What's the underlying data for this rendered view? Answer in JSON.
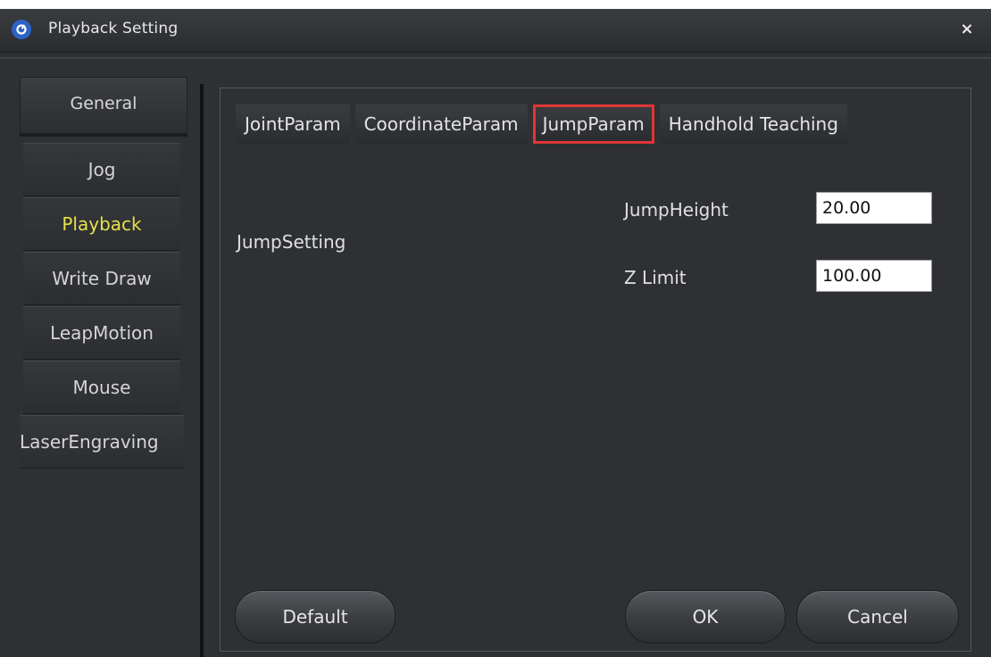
{
  "window": {
    "title": "Playback Setting",
    "close_symbol": "×",
    "app_icon": "dobot-logo-icon"
  },
  "nav": {
    "general_label": "General",
    "items": [
      {
        "label": "Jog"
      },
      {
        "label": "Playback"
      },
      {
        "label": "Write  Draw"
      },
      {
        "label": "LeapMotion"
      },
      {
        "label": "Mouse"
      },
      {
        "label": "LaserEngraving"
      }
    ],
    "active_item": "Playback",
    "active_color": "#e6e04a"
  },
  "tabs": {
    "items": [
      {
        "label": "JointParam"
      },
      {
        "label": "CoordinateParam"
      },
      {
        "label": "JumpParam"
      },
      {
        "label": "Handhold Teaching"
      }
    ],
    "selected": "JumpParam",
    "highlight_color": "#e03535"
  },
  "jump": {
    "section_label": "JumpSetting",
    "height_label": "JumpHeight",
    "height_value": "20.00",
    "zlimit_label": "Z Limit",
    "zlimit_value": "100.00"
  },
  "buttons": {
    "default_label": "Default",
    "ok_label": "OK",
    "cancel_label": "Cancel"
  }
}
